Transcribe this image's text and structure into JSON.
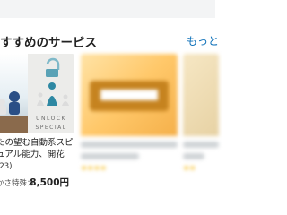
{
  "section": {
    "title": "すすめのサービス",
    "more_label": "もっと"
  },
  "cards": [
    {
      "thumbnail_text": "UNLOCK SPECIAL",
      "title": "たの望む自動系スピ ュアル能力、開花さ…",
      "rating_count": "(23)",
      "seller": "かさ特殊カ…",
      "price": "8,500円"
    }
  ],
  "colors": {
    "link": "#0b6fb8",
    "star": "#f5b400"
  }
}
